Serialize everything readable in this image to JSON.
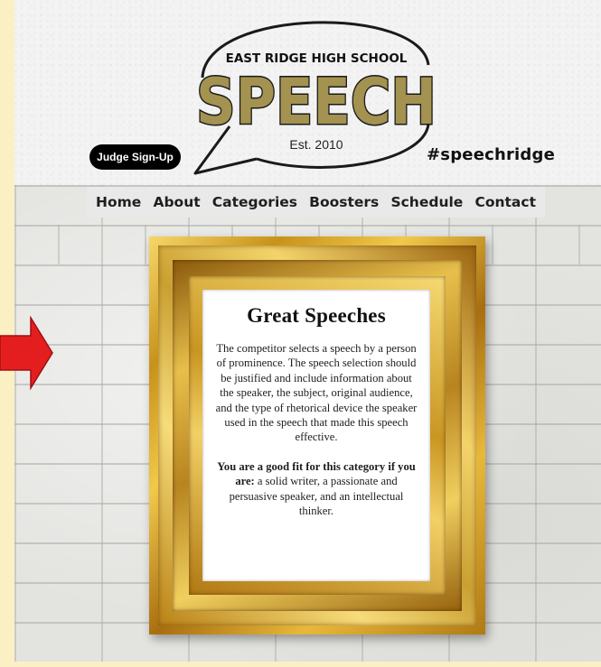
{
  "header": {
    "school_name": "EAST RIDGE HIGH SCHOOL",
    "logo_word": "SPEECH",
    "established": "Est. 2010",
    "judge_button": "Judge Sign-Up",
    "hashtag": "#speechridge"
  },
  "nav": {
    "items": [
      "Home",
      "About",
      "Categories",
      "Boosters",
      "Schedule",
      "Contact"
    ]
  },
  "category": {
    "title": "Great Speeches",
    "description": "The competitor selects a speech by a person of prominence. The speech selection should be justified and include information about the speaker, the subject, original audience, and the type of rhetorical device the speaker used in the speech that made this speech effective.",
    "fit_label": "You are a good fit for this category if you are:",
    "fit_text": " a solid writer, a passionate and persuasive speaker, and an intellectual thinker."
  },
  "colors": {
    "logo_olive": "#a39250",
    "arrow_red": "#e41e1e",
    "frame_gold": "#d9a72c",
    "side_cream": "#fbefc4"
  },
  "icons": {
    "arrow": "arrow-right-icon"
  }
}
